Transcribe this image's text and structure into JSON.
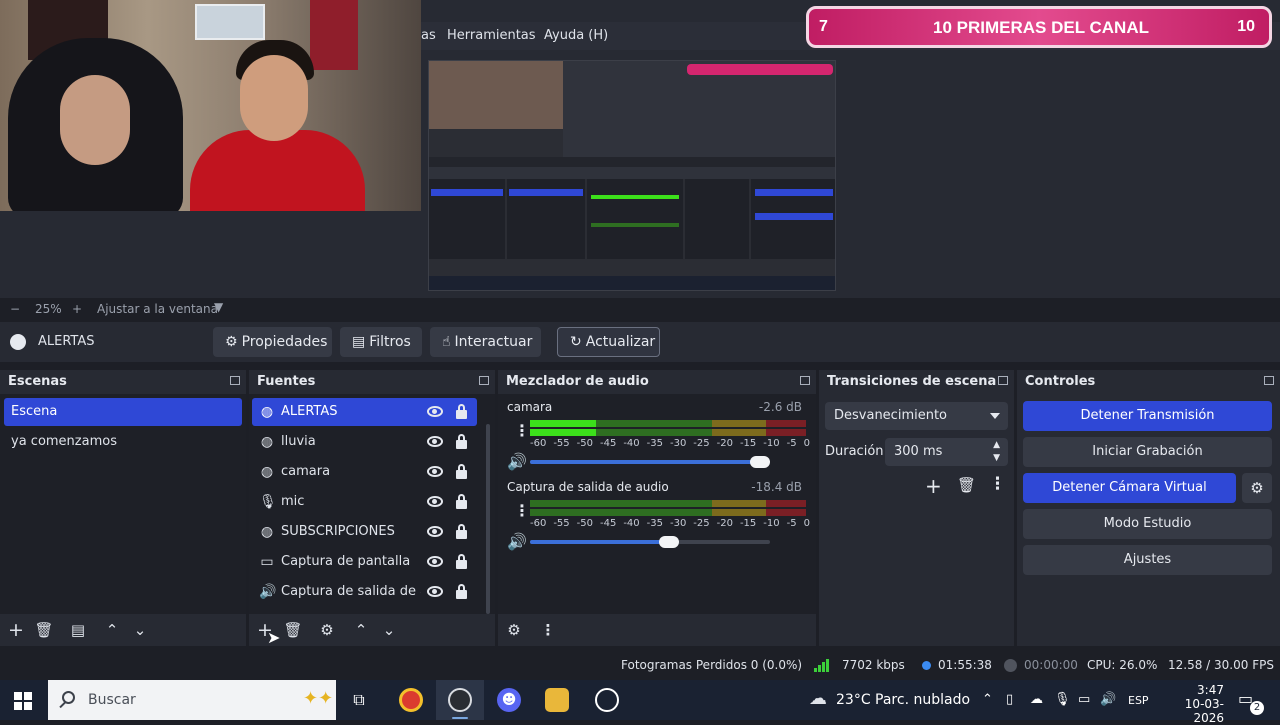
{
  "banner": {
    "left": "7",
    "title": "10 PRIMERAS DEL CANAL",
    "right": "10"
  },
  "menubar": {
    "item_partial": "as",
    "item_tools": "Herramientas",
    "item_help": "Ayuda (H)"
  },
  "zoombar": {
    "minus": "−",
    "zoom": "25%",
    "plus": "+",
    "fit": "Ajustar a la ventana"
  },
  "source_toolbar": {
    "current_source": "ALERTAS",
    "properties": "Propiedades",
    "filters": "Filtros",
    "interact": "Interactuar",
    "refresh": "Actualizar"
  },
  "scenes": {
    "title": "Escenas",
    "items": [
      {
        "label": "Escena",
        "selected": true
      },
      {
        "label": "ya comenzamos",
        "selected": false
      }
    ]
  },
  "sources": {
    "title": "Fuentes",
    "items": [
      {
        "label": "ALERTAS",
        "icon": "globe-icon",
        "selected": true
      },
      {
        "label": "lluvia",
        "icon": "globe-icon"
      },
      {
        "label": "camara",
        "icon": "globe-icon"
      },
      {
        "label": "mic",
        "icon": "microphone-icon"
      },
      {
        "label": "SUBSCRIPCIONES",
        "icon": "globe-icon"
      },
      {
        "label": "Captura de pantalla",
        "icon": "monitor-icon"
      },
      {
        "label": "Captura de salida de audio",
        "icon": "speaker-icon"
      }
    ]
  },
  "mixer": {
    "title": "Mezclador de audio",
    "channels": [
      {
        "name": "camara",
        "db": "-2.6 dB",
        "level": 0.24,
        "volume": 0.96
      },
      {
        "name": "Captura de salida de audio",
        "db": "-18.4 dB",
        "level": 0.0,
        "volume": 0.58
      }
    ],
    "scale": [
      "-60",
      "-55",
      "-50",
      "-45",
      "-40",
      "-35",
      "-30",
      "-25",
      "-20",
      "-15",
      "-10",
      "-5",
      "0"
    ]
  },
  "transitions": {
    "title": "Transiciones de escena",
    "selected": "Desvanecimiento",
    "duration_label": "Duración",
    "duration_value": "300 ms"
  },
  "controls": {
    "title": "Controles",
    "stop_stream": "Detener Transmisión",
    "start_record": "Iniciar Grabación",
    "stop_virtualcam": "Detener Cámara Virtual",
    "studio_mode": "Modo Estudio",
    "settings": "Ajustes"
  },
  "status": {
    "dropped": "Fotogramas Perdidos 0 (0.0%)",
    "bitrate": "7702 kbps",
    "live_time": "01:55:38",
    "rec_time": "00:00:00",
    "cpu": "CPU: 26.0%",
    "fps": "12.58 / 30.00 FPS"
  },
  "taskbar": {
    "search_placeholder": "Buscar",
    "weather": "23°C  Parc. nublado",
    "lang": "ESP",
    "time": "3:47",
    "date": "10-03-2026",
    "notif_count": "2"
  },
  "colors": {
    "accent": "#2f48d6",
    "banner": "#d5266f",
    "meter_green": "#3ce01b"
  }
}
